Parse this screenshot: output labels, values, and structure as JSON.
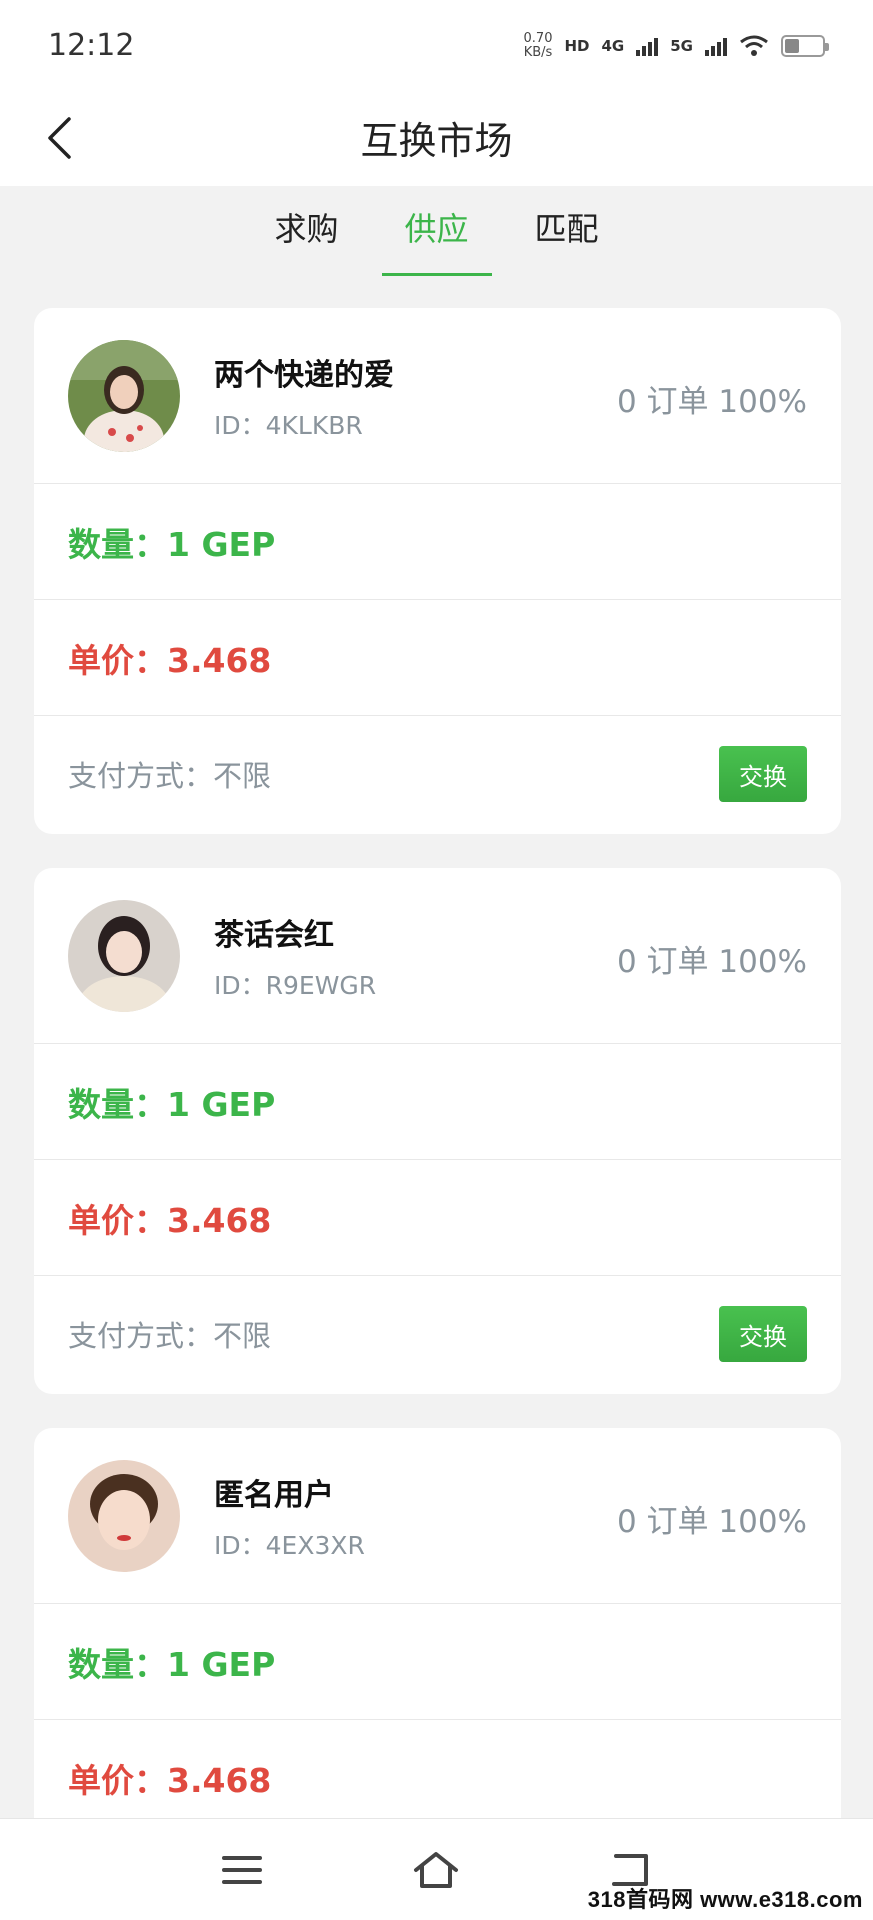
{
  "status_bar": {
    "time": "12:12",
    "speed_value": "0.70",
    "speed_unit": "KB/s",
    "hd_label": "HD",
    "net1": "4G",
    "net2": "5G"
  },
  "header": {
    "title": "互换市场"
  },
  "tabs": [
    {
      "label": "求购",
      "active": false
    },
    {
      "label": "供应",
      "active": true
    },
    {
      "label": "匹配",
      "active": false
    }
  ],
  "listings": [
    {
      "name": "两个快递的爱",
      "id": "ID：4KLKBR",
      "stats": "0 订单 100%",
      "quantity": "数量：1 GEP",
      "price": "单价：3.468",
      "payment": "支付方式：不限",
      "button": "交换"
    },
    {
      "name": "茶话会红",
      "id": "ID：R9EWGR",
      "stats": "0 订单 100%",
      "quantity": "数量：1 GEP",
      "price": "单价：3.468",
      "payment": "支付方式：不限",
      "button": "交换"
    },
    {
      "name": "匿名用户",
      "id": "ID：4EX3XR",
      "stats": "0 订单 100%",
      "quantity": "数量：1 GEP",
      "price": "单价：3.468"
    }
  ],
  "watermark": "318首码网 www.e318.com",
  "colors": {
    "accent_green": "#3cb54a",
    "price_red": "#e04a3f",
    "muted_text": "#8a949c",
    "background": "#f2f2f2"
  },
  "icons": {
    "back": "chevron-left-icon",
    "menu": "menu-icon",
    "home": "home-icon",
    "return": "return-icon"
  }
}
